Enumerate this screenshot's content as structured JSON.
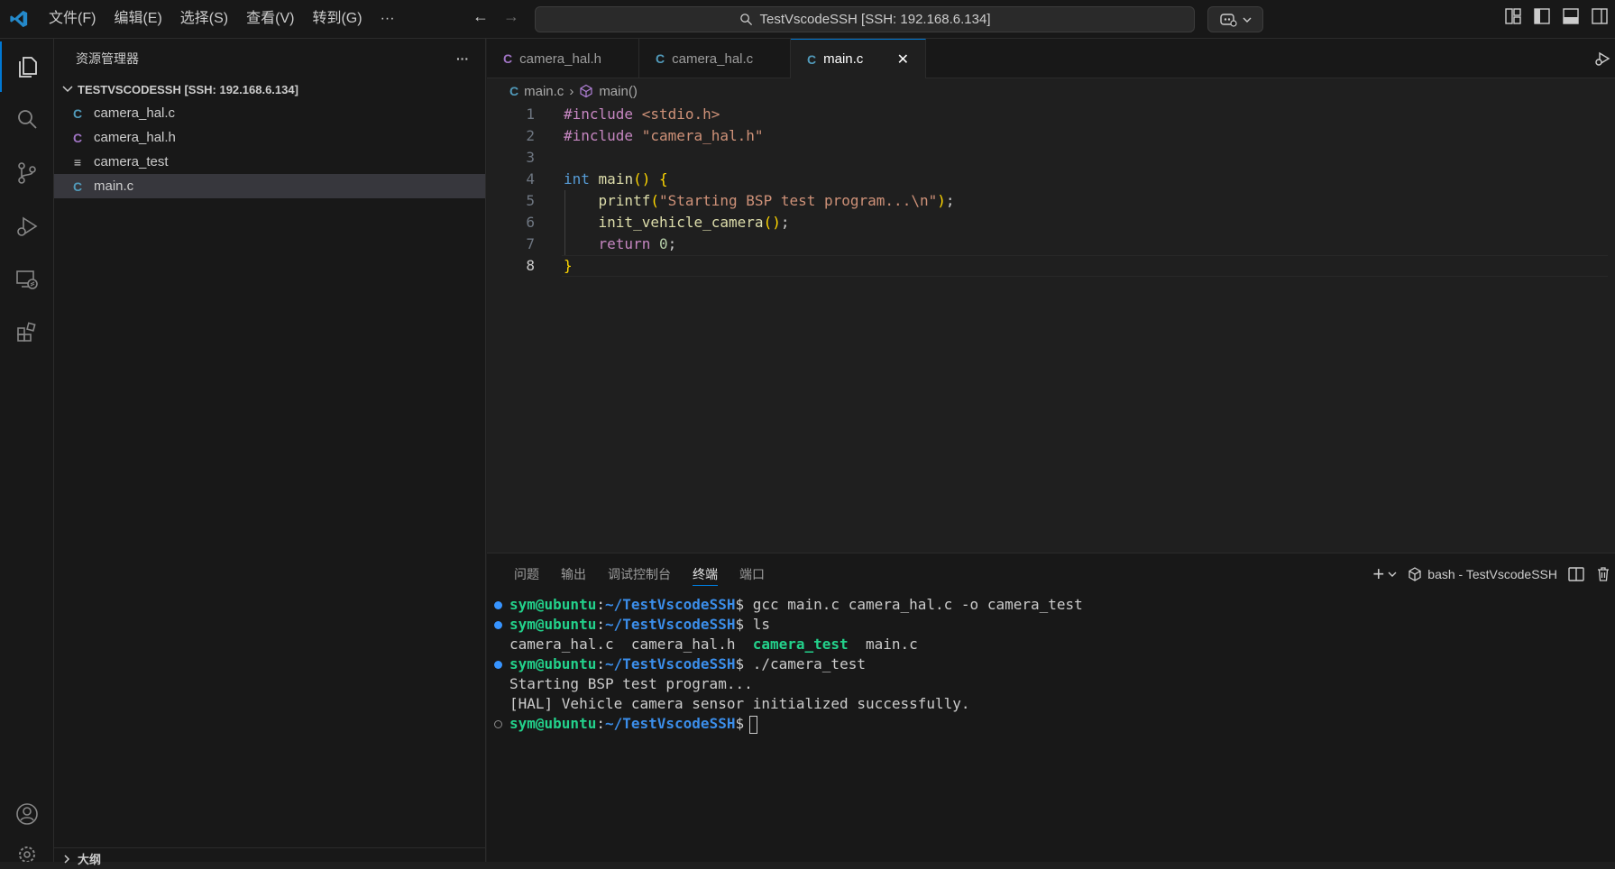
{
  "titlebar": {
    "menus": [
      "文件(F)",
      "编辑(E)",
      "选择(S)",
      "查看(V)",
      "转到(G)",
      "···"
    ],
    "command_center": "TestVscodeSSH [SSH: 192.168.6.134]"
  },
  "sidebar": {
    "title": "资源管理器",
    "more": "···",
    "folder": "TESTVSCODESSH [SSH: 192.168.6.134]",
    "files": [
      {
        "name": "camera_hal.c",
        "icon": "c-file-icon",
        "icon_char": "C",
        "color": "#519aba"
      },
      {
        "name": "camera_hal.h",
        "icon": "c-header-icon",
        "icon_char": "C",
        "color": "#a074c4"
      },
      {
        "name": "camera_test",
        "icon": "text-file-icon",
        "icon_char": "≡",
        "color": "#cccccc"
      },
      {
        "name": "main.c",
        "icon": "c-file-icon",
        "icon_char": "C",
        "color": "#519aba"
      }
    ],
    "outline": "大纲"
  },
  "editor": {
    "tabs": [
      {
        "label": "camera_hal.h",
        "icon_char": "C",
        "color": "#a074c4"
      },
      {
        "label": "camera_hal.c",
        "icon_char": "C",
        "color": "#519aba"
      },
      {
        "label": "main.c",
        "icon_char": "C",
        "color": "#519aba",
        "close": "✕"
      }
    ],
    "breadcrumb": {
      "file": "main.c",
      "symbol": "main()"
    },
    "lines": [
      {
        "n": "1",
        "tokens": [
          {
            "t": "#include ",
            "c": "pp"
          },
          {
            "t": "<stdio.h>",
            "c": "str"
          }
        ]
      },
      {
        "n": "2",
        "tokens": [
          {
            "t": "#include ",
            "c": "pp"
          },
          {
            "t": "\"camera_hal.h\"",
            "c": "str"
          }
        ]
      },
      {
        "n": "3",
        "tokens": []
      },
      {
        "n": "4",
        "tokens": [
          {
            "t": "int",
            "c": "kw"
          },
          {
            "t": " ",
            "c": "punc"
          },
          {
            "t": "main",
            "c": "fn"
          },
          {
            "t": "()",
            "c": "paren"
          },
          {
            "t": " ",
            "c": "punc"
          },
          {
            "t": "{",
            "c": "paren"
          }
        ]
      },
      {
        "n": "5",
        "tokens": [
          {
            "t": "    ",
            "c": "punc"
          },
          {
            "t": "printf",
            "c": "fn"
          },
          {
            "t": "(",
            "c": "paren"
          },
          {
            "t": "\"Starting BSP test program...\\n\"",
            "c": "str"
          },
          {
            "t": ")",
            "c": "paren"
          },
          {
            "t": ";",
            "c": "punc"
          }
        ]
      },
      {
        "n": "6",
        "tokens": [
          {
            "t": "    ",
            "c": "punc"
          },
          {
            "t": "init_vehicle_camera",
            "c": "fn"
          },
          {
            "t": "()",
            "c": "paren"
          },
          {
            "t": ";",
            "c": "punc"
          }
        ]
      },
      {
        "n": "7",
        "tokens": [
          {
            "t": "    ",
            "c": "punc"
          },
          {
            "t": "return",
            "c": "ctrl"
          },
          {
            "t": " ",
            "c": "punc"
          },
          {
            "t": "0",
            "c": "num"
          },
          {
            "t": ";",
            "c": "punc"
          }
        ]
      },
      {
        "n": "8",
        "tokens": [
          {
            "t": "}",
            "c": "paren"
          }
        ]
      }
    ]
  },
  "panel": {
    "tabs": [
      "问题",
      "输出",
      "调试控制台",
      "终端",
      "端口"
    ],
    "active_tab": 3,
    "terminal_name": "bash - TestVscodeSSH",
    "terminal": [
      {
        "deco": "filled",
        "parts": [
          {
            "t": "sym@ubuntu",
            "c": "user"
          },
          {
            "t": ":",
            "c": "plain"
          },
          {
            "t": "~/TestVscodeSSH",
            "c": "path"
          },
          {
            "t": "$ gcc main.c camera_hal.c -o camera_test",
            "c": "plain"
          }
        ]
      },
      {
        "deco": "filled",
        "parts": [
          {
            "t": "sym@ubuntu",
            "c": "user"
          },
          {
            "t": ":",
            "c": "plain"
          },
          {
            "t": "~/TestVscodeSSH",
            "c": "path"
          },
          {
            "t": "$ ls",
            "c": "plain"
          }
        ]
      },
      {
        "deco": "none",
        "parts": [
          {
            "t": "camera_hal.c  camera_hal.h  ",
            "c": "plain"
          },
          {
            "t": "camera_test",
            "c": "exe"
          },
          {
            "t": "  main.c",
            "c": "plain"
          }
        ]
      },
      {
        "deco": "filled",
        "parts": [
          {
            "t": "sym@ubuntu",
            "c": "user"
          },
          {
            "t": ":",
            "c": "plain"
          },
          {
            "t": "~/TestVscodeSSH",
            "c": "path"
          },
          {
            "t": "$ ./camera_test",
            "c": "plain"
          }
        ]
      },
      {
        "deco": "none",
        "parts": [
          {
            "t": "Starting BSP test program...",
            "c": "plain"
          }
        ]
      },
      {
        "deco": "none",
        "parts": [
          {
            "t": "[HAL] Vehicle camera sensor initialized successfully.",
            "c": "plain"
          }
        ]
      },
      {
        "deco": "hollow",
        "parts": [
          {
            "t": "sym@ubuntu",
            "c": "user"
          },
          {
            "t": ":",
            "c": "plain"
          },
          {
            "t": "~/TestVscodeSSH",
            "c": "path"
          },
          {
            "t": "$",
            "c": "plain"
          }
        ],
        "cursor": true
      }
    ]
  },
  "colors": {
    "accent": "#0078d4",
    "bg": "#1f1f1f",
    "sidebar_bg": "#181818"
  }
}
